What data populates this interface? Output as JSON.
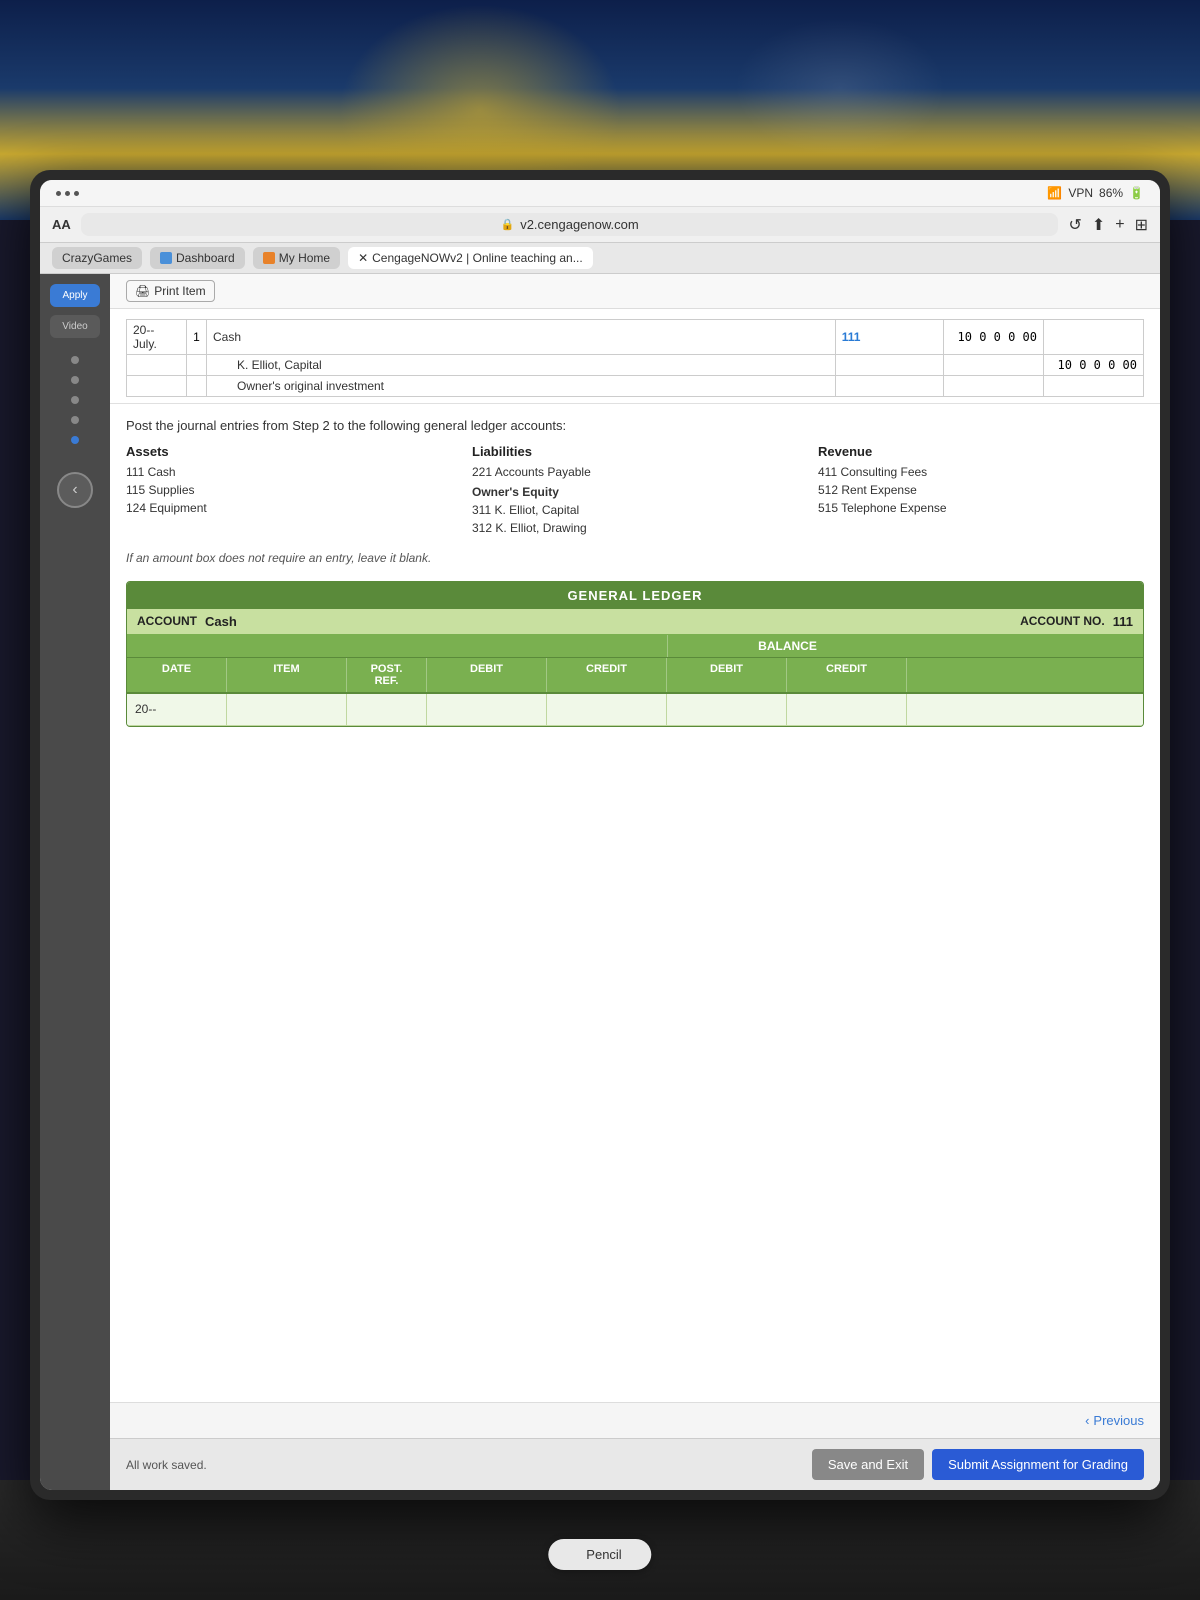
{
  "photo": {
    "alt": "Sports jersey background"
  },
  "status_bar": {
    "dots_label": "...",
    "wifi": "WiFi",
    "vpn": "VPN",
    "battery": "86%"
  },
  "browser": {
    "aa_label": "AA",
    "url": "v2.cengagenow.com",
    "lock_icon": "🔒",
    "reload_icon": "↺",
    "share_icon": "⬆",
    "plus_icon": "+",
    "grid_icon": "⊞"
  },
  "tabs": [
    {
      "label": "CrazyGames",
      "icon_type": "default",
      "active": false
    },
    {
      "label": "Dashboard",
      "icon_type": "blue",
      "active": false
    },
    {
      "label": "My Home",
      "icon_type": "orange",
      "active": false
    },
    {
      "label": "CengageNOWv2 | Online teaching an...",
      "icon_type": "default",
      "active": true
    }
  ],
  "sidebar": {
    "apply_label": "Apply",
    "video_label": "Video",
    "dots": [
      {
        "active": false
      },
      {
        "active": false
      },
      {
        "active": false
      },
      {
        "active": false
      },
      {
        "active": true
      }
    ],
    "nav_arrow": "‹"
  },
  "toolbar": {
    "print_label": "Print Item"
  },
  "journal": {
    "date": "20--",
    "month": "July.",
    "day": "1",
    "account1": "Cash",
    "account_no1": "111",
    "amount1": "10 0 0 0 00",
    "account2": "K. Elliot, Capital",
    "amount2": "10 0 0 0 00",
    "description": "Owner's original investment"
  },
  "instructions": {
    "text": "Post the journal entries from Step 2 to the following general ledger accounts:"
  },
  "accounts": {
    "assets": {
      "heading": "Assets",
      "items": [
        "111 Cash",
        "115 Supplies",
        "124 Equipment"
      ]
    },
    "liabilities": {
      "heading": "Liabilities",
      "items": [
        "221 Accounts Payable",
        "",
        "Owner's Equity",
        "311 K. Elliot, Capital",
        "312 K. Elliot, Drawing"
      ]
    },
    "revenue": {
      "heading": "Revenue",
      "items": [
        "411 Consulting Fees",
        "512 Rent Expense",
        "515 Telephone Expense"
      ]
    }
  },
  "notice": {
    "text": "If an amount box does not require an entry, leave it blank."
  },
  "ledger": {
    "title": "GENERAL LEDGER",
    "account_label": "ACCOUNT",
    "account_name": "Cash",
    "account_no_label": "ACCOUNT NO.",
    "account_no": "111",
    "balance_label": "BALANCE",
    "col_headers": {
      "date": "DATE",
      "item": "ITEM",
      "post_ref": "POST.\nREF.",
      "debit": "DEBIT",
      "credit": "CREDIT",
      "balance_debit": "DEBIT",
      "balance_credit": "CREDIT"
    },
    "rows": [
      {
        "date": "20--",
        "item": "",
        "post_ref": "",
        "debit": "",
        "credit": "",
        "bal_debit": "",
        "bal_credit": ""
      }
    ]
  },
  "bottom": {
    "previous_label": "Previous"
  },
  "footer": {
    "work_saved": "All work saved.",
    "save_exit_label": "Save and Exit",
    "submit_label": "Submit Assignment for Grading"
  },
  "pencil": {
    "apple_logo": "",
    "label": "Pencil"
  }
}
